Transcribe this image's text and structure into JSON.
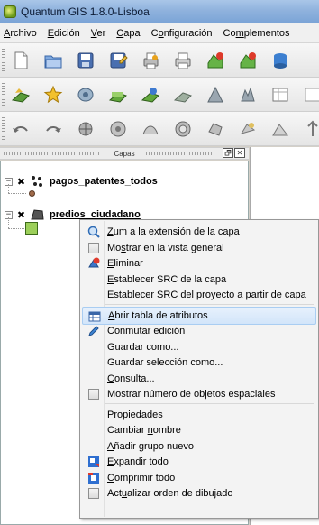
{
  "window": {
    "title": "Quantum GIS 1.8.0-Lisboa"
  },
  "menubar": {
    "items": [
      {
        "label": "Archivo",
        "mnemonic": "A",
        "rest": "rchivo"
      },
      {
        "label": "Edición",
        "mnemonic": "E",
        "rest": "dición"
      },
      {
        "label": "Ver",
        "mnemonic": "V",
        "rest": "er"
      },
      {
        "label": "Capa",
        "mnemonic": "C",
        "rest": "apa"
      },
      {
        "label": "Configuración",
        "pre": "C",
        "mnemonic": "o",
        "rest": "nfiguración"
      },
      {
        "label": "Complementos",
        "pre": "Co",
        "mnemonic": "m",
        "rest": "plementos"
      }
    ]
  },
  "layers_panel": {
    "title": "Capas",
    "float_button": "🗗",
    "close_button": "✕",
    "layers": [
      {
        "name": "pagos_patentes_todos",
        "checked_glyph": "✖",
        "expander": "−"
      },
      {
        "name": "predios_ciudadano",
        "checked_glyph": "✖",
        "expander": "−"
      }
    ]
  },
  "context_menu": {
    "items": [
      {
        "type": "item",
        "pre": "",
        "mnemonic": "Z",
        "rest": "um a la extensión de la capa",
        "icon": "zoom-icon"
      },
      {
        "type": "check",
        "pre": "Mo",
        "mnemonic": "s",
        "rest": "trar en la vista general"
      },
      {
        "type": "item",
        "pre": "",
        "mnemonic": "E",
        "rest": "liminar",
        "icon": "remove-layer-icon"
      },
      {
        "type": "item",
        "pre": "",
        "mnemonic": "E",
        "rest": "stablecer SRC de la capa"
      },
      {
        "type": "item",
        "pre": "",
        "mnemonic": "E",
        "rest": "stablecer SRC del proyecto a partir de capa"
      },
      {
        "type": "sep"
      },
      {
        "type": "item",
        "pre": "",
        "mnemonic": "A",
        "rest": "brir tabla de atributos",
        "icon": "table-icon",
        "highlighted": true
      },
      {
        "type": "item",
        "pre": "",
        "mnemonic": "",
        "rest": "Conmutar edición",
        "icon": "pencil-icon"
      },
      {
        "type": "item",
        "pre": "",
        "mnemonic": "",
        "rest": "Guardar como..."
      },
      {
        "type": "item",
        "pre": "",
        "mnemonic": "",
        "rest": "Guardar selección como..."
      },
      {
        "type": "item",
        "pre": "",
        "mnemonic": "C",
        "rest": "onsulta..."
      },
      {
        "type": "check",
        "pre": "",
        "mnemonic": "",
        "rest": "Mostrar número de objetos espaciales"
      },
      {
        "type": "sep"
      },
      {
        "type": "item",
        "pre": "",
        "mnemonic": "P",
        "rest": "ropiedades"
      },
      {
        "type": "item",
        "pre": "Cambiar ",
        "mnemonic": "n",
        "rest": "ombre"
      },
      {
        "type": "item",
        "pre": "",
        "mnemonic": "A",
        "rest": "ñadir grupo nuevo"
      },
      {
        "type": "item",
        "pre": "",
        "mnemonic": "E",
        "rest": "xpandir todo",
        "icon": "expand-all-icon"
      },
      {
        "type": "item",
        "pre": "",
        "mnemonic": "C",
        "rest": "omprimir todo",
        "icon": "collapse-all-icon"
      },
      {
        "type": "check",
        "pre": "Act",
        "mnemonic": "u",
        "rest": "alizar orden de dibujado"
      }
    ]
  }
}
